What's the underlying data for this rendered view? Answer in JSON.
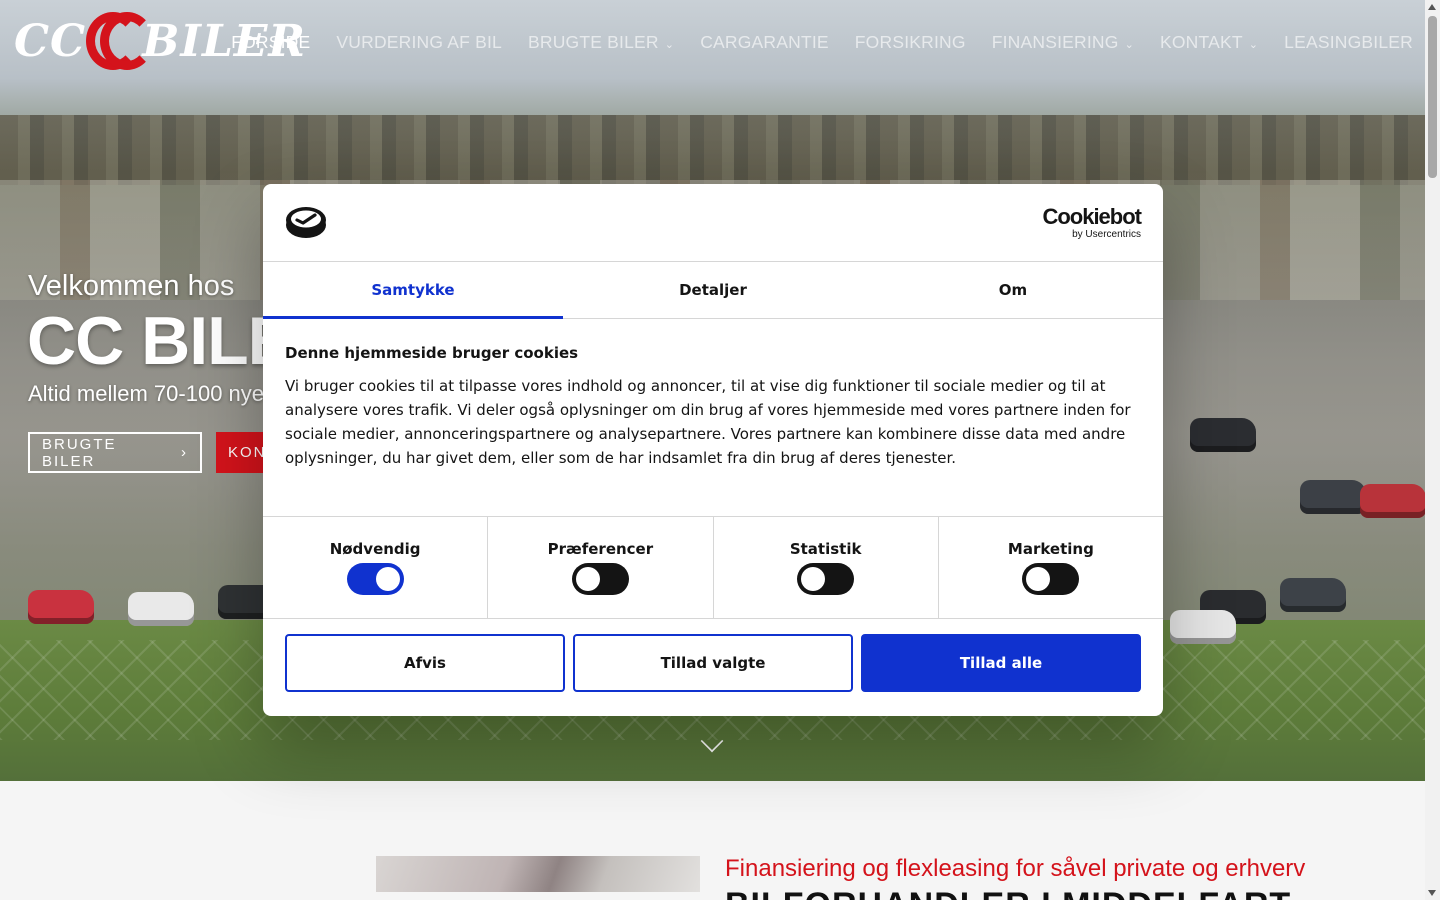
{
  "header": {
    "logo_text_left": "CC",
    "logo_text_right": "BILER",
    "nav": [
      {
        "label": "FORSIDE",
        "active": true,
        "dropdown": false
      },
      {
        "label": "VURDERING AF BIL",
        "active": false,
        "dropdown": false
      },
      {
        "label": "BRUGTE BILER",
        "active": false,
        "dropdown": true
      },
      {
        "label": "CARGARANTIE",
        "active": false,
        "dropdown": false
      },
      {
        "label": "FORSIKRING",
        "active": false,
        "dropdown": false
      },
      {
        "label": "FINANSIERING",
        "active": false,
        "dropdown": true
      },
      {
        "label": "KONTAKT",
        "active": false,
        "dropdown": true
      },
      {
        "label": "LEASINGBILER",
        "active": false,
        "dropdown": false
      }
    ]
  },
  "hero": {
    "welcome": "Velkommen hos",
    "brand": "CC BILER",
    "tagline": "Altid mellem 70-100 nye",
    "btn_used": "BRUGTE BILER",
    "btn_contact": "KON",
    "chevron_icon": "chevron-right-icon",
    "scroll_icon": "chevron-down-icon"
  },
  "below": {
    "subtitle": "Finansiering og flexleasing for såvel private og erhverv",
    "heading": "BILFORHANDLER I MIDDELFART"
  },
  "cookie": {
    "provider_name": "Cookiebot",
    "provider_by": "by Usercentrics",
    "tabs": [
      {
        "label": "Samtykke",
        "active": true
      },
      {
        "label": "Detaljer",
        "active": false
      },
      {
        "label": "Om",
        "active": false
      }
    ],
    "title": "Denne hjemmeside bruger cookies",
    "body": "Vi bruger cookies til at tilpasse vores indhold og annoncer, til at vise dig funktioner til sociale medier og til at analysere vores trafik. Vi deler også oplysninger om din brug af vores hjemmeside med vores partnere inden for sociale medier, annonceringspartnere og analysepartnere. Vores partnere kan kombinere disse data med andre oplysninger, du har givet dem, eller som de har indsamlet fra din brug af deres tjenester.",
    "toggles": [
      {
        "label": "Nødvendig",
        "on": true
      },
      {
        "label": "Præferencer",
        "on": false
      },
      {
        "label": "Statistik",
        "on": false
      },
      {
        "label": "Marketing",
        "on": false
      }
    ],
    "buttons": {
      "deny": "Afvis",
      "allow_selected": "Tillad valgte",
      "allow_all": "Tillad alle"
    }
  },
  "colors": {
    "accent_blue": "#1032cf",
    "brand_red": "#d4131b",
    "dark": "#141414"
  }
}
